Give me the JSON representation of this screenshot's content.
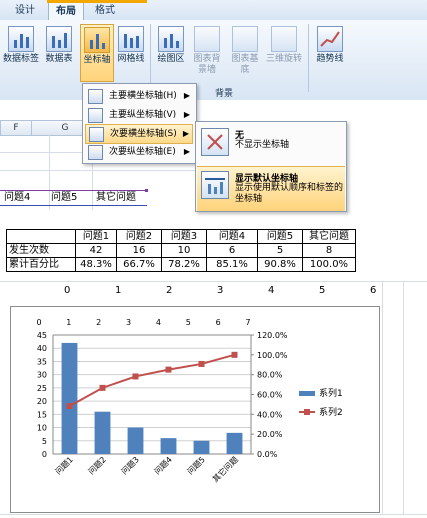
{
  "ribbon": {
    "tabs": [
      {
        "label": "设计",
        "active": false
      },
      {
        "label": "布局",
        "active": true
      },
      {
        "label": "格式",
        "active": false
      }
    ],
    "buttons": [
      {
        "name": "data-labels",
        "label": "数据标签"
      },
      {
        "name": "data-table",
        "label": "数据表"
      },
      {
        "name": "axes",
        "label": "坐标轴"
      },
      {
        "name": "gridlines",
        "label": "网格线"
      },
      {
        "name": "plot-area",
        "label": "绘图区"
      },
      {
        "name": "chart-wall",
        "label": "图表背景墙"
      },
      {
        "name": "chart-floor",
        "label": "图表基底"
      },
      {
        "name": "3d-rotation",
        "label": "三维旋转"
      },
      {
        "name": "trendline",
        "label": "趋势线"
      }
    ],
    "group_label": "背景"
  },
  "axes_menu": {
    "items": [
      {
        "label": "主要横坐标轴(H)",
        "highlighted": false
      },
      {
        "label": "主要纵坐标轴(V)",
        "highlighted": false
      },
      {
        "label": "次要横坐标轴(S)",
        "highlighted": true
      },
      {
        "label": "次要纵坐标轴(E)",
        "highlighted": false
      }
    ]
  },
  "submenu": {
    "items": [
      {
        "title": "无",
        "desc": "不显示坐标轴",
        "highlighted": false
      },
      {
        "title": "显示默认坐标轴",
        "desc": "显示使用默认顺序和标签的坐标轴",
        "highlighted": true
      }
    ]
  },
  "sheet_top": {
    "col_headers": [
      "F",
      "G"
    ],
    "cells": [
      "问题4",
      "问题5",
      "其它问题"
    ]
  },
  "table": {
    "header": [
      "",
      "问题1",
      "问题2",
      "问题3",
      "问题4",
      "问题5",
      "其它问题"
    ],
    "rows": [
      {
        "label": "发生次数",
        "values": [
          "42",
          "16",
          "10",
          "6",
          "5",
          "8"
        ]
      },
      {
        "label": "累计百分比",
        "values": [
          "48.3%",
          "66.7%",
          "78.2%",
          "85.1%",
          "90.8%",
          "100.0%"
        ]
      }
    ]
  },
  "outer_axis_numbers": [
    "0",
    "1",
    "2",
    "3",
    "4",
    "5",
    "6"
  ],
  "chart_data": {
    "type": "bar",
    "categories": [
      "问题1",
      "问题2",
      "问题3",
      "问题4",
      "问题5",
      "其它问题"
    ],
    "series": [
      {
        "name": "系列1",
        "type": "bar",
        "axis": "left",
        "values": [
          42,
          16,
          10,
          6,
          5,
          8
        ],
        "color": "#4f81bd"
      },
      {
        "name": "系列2",
        "type": "line",
        "axis": "right",
        "values": [
          48.3,
          66.7,
          78.2,
          85.1,
          90.8,
          100.0
        ],
        "color": "#c0504d"
      }
    ],
    "ylim_left": [
      0,
      45
    ],
    "yticks_left": [
      "0",
      "5",
      "10",
      "15",
      "20",
      "25",
      "30",
      "35",
      "40",
      "45"
    ],
    "ylim_right": [
      0,
      120
    ],
    "yticks_right": [
      "0.0%",
      "20.0%",
      "40.0%",
      "60.0%",
      "80.0%",
      "100.0%",
      "120.0%"
    ],
    "secondary_x_ticks": [
      "0",
      "1",
      "2",
      "3",
      "4",
      "5",
      "6",
      "7"
    ],
    "secondary_xlim": [
      0,
      7
    ],
    "legend_position": "right",
    "grid": true
  }
}
